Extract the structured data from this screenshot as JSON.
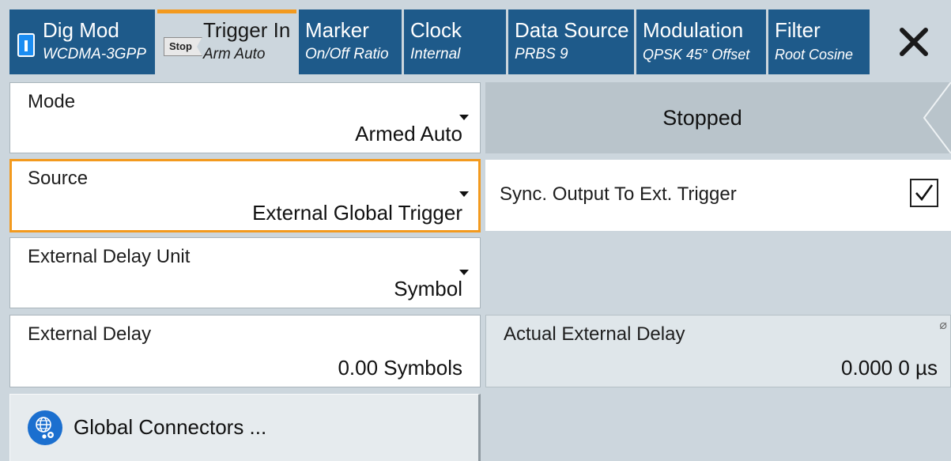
{
  "tabs": [
    {
      "title": "Dig Mod",
      "sub": "WCDMA-3GPP"
    },
    {
      "title": "Trigger In",
      "sub": "Arm Auto",
      "badge": "Stop"
    },
    {
      "title": "Marker",
      "sub": "On/Off Ratio"
    },
    {
      "title": "Clock",
      "sub": "Internal"
    },
    {
      "title": "Data Source",
      "sub": "PRBS 9"
    },
    {
      "title": "Modulation",
      "sub": "QPSK 45° Offset"
    },
    {
      "title": "Filter",
      "sub": "Root Cosine"
    }
  ],
  "fields": {
    "mode": {
      "label": "Mode",
      "value": "Armed Auto"
    },
    "source": {
      "label": "Source",
      "value": "External Global Trigger"
    },
    "delay_unit": {
      "label": "External Delay Unit",
      "value": "Symbol"
    },
    "external_delay": {
      "label": "External Delay",
      "value": "0.00  Symbols"
    },
    "actual_delay": {
      "label": "Actual External Delay",
      "value": "0.000 0 µs"
    }
  },
  "status_button": "Stopped",
  "sync_output": {
    "label": "Sync. Output To Ext. Trigger",
    "checked": true
  },
  "global_connectors": "Global Connectors ...",
  "colors": {
    "tab_bg": "#1e5a8a",
    "accent": "#f39a1e",
    "page_bg": "#ccd6dd",
    "icon_blue": "#1b6fcf"
  }
}
